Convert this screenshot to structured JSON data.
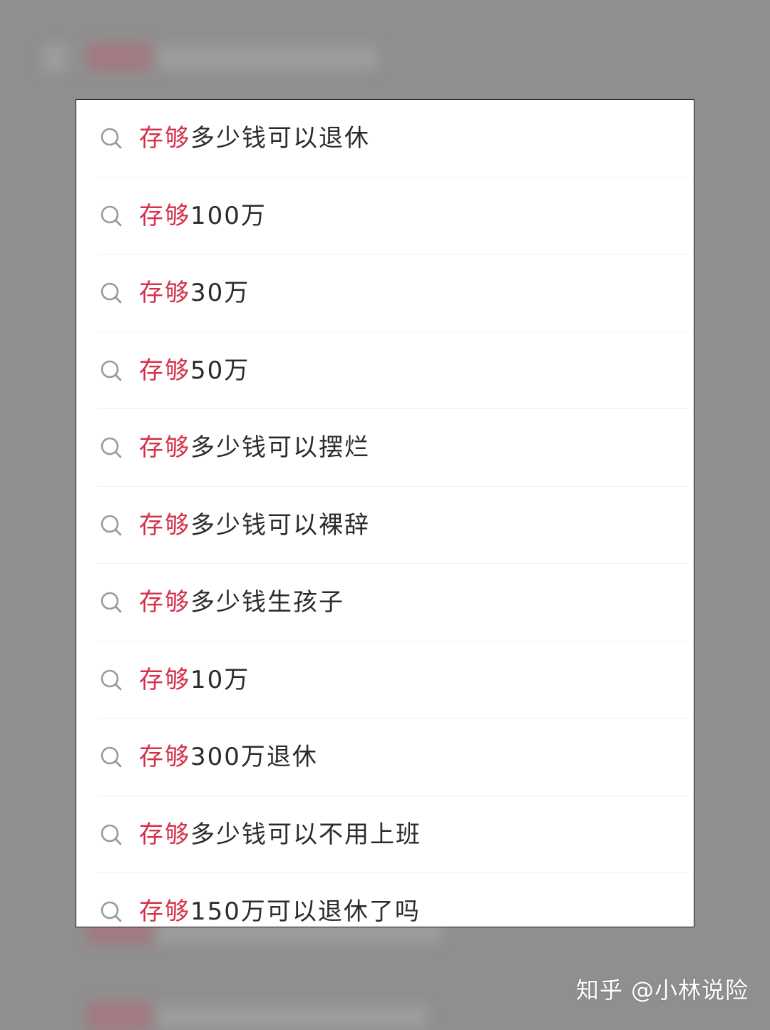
{
  "colors": {
    "highlight": "#d4314a",
    "text": "#2b2b2b",
    "icon": "#9a9a9a",
    "overlay": "#8f8f8f"
  },
  "icon": "search-icon",
  "suggestions": [
    {
      "highlight": "存够",
      "rest": "多少钱可以退休"
    },
    {
      "highlight": "存够",
      "rest": "100万"
    },
    {
      "highlight": "存够",
      "rest": "30万"
    },
    {
      "highlight": "存够",
      "rest": "50万"
    },
    {
      "highlight": "存够",
      "rest": "多少钱可以摆烂"
    },
    {
      "highlight": "存够",
      "rest": "多少钱可以裸辞"
    },
    {
      "highlight": "存够",
      "rest": "多少钱生孩子"
    },
    {
      "highlight": "存够",
      "rest": "10万"
    },
    {
      "highlight": "存够",
      "rest": "300万退休"
    },
    {
      "highlight": "存够",
      "rest": "多少钱可以不用上班"
    },
    {
      "highlight": "存够",
      "rest": "150万可以退休了吗"
    }
  ],
  "watermark": "知乎 @小林说险"
}
